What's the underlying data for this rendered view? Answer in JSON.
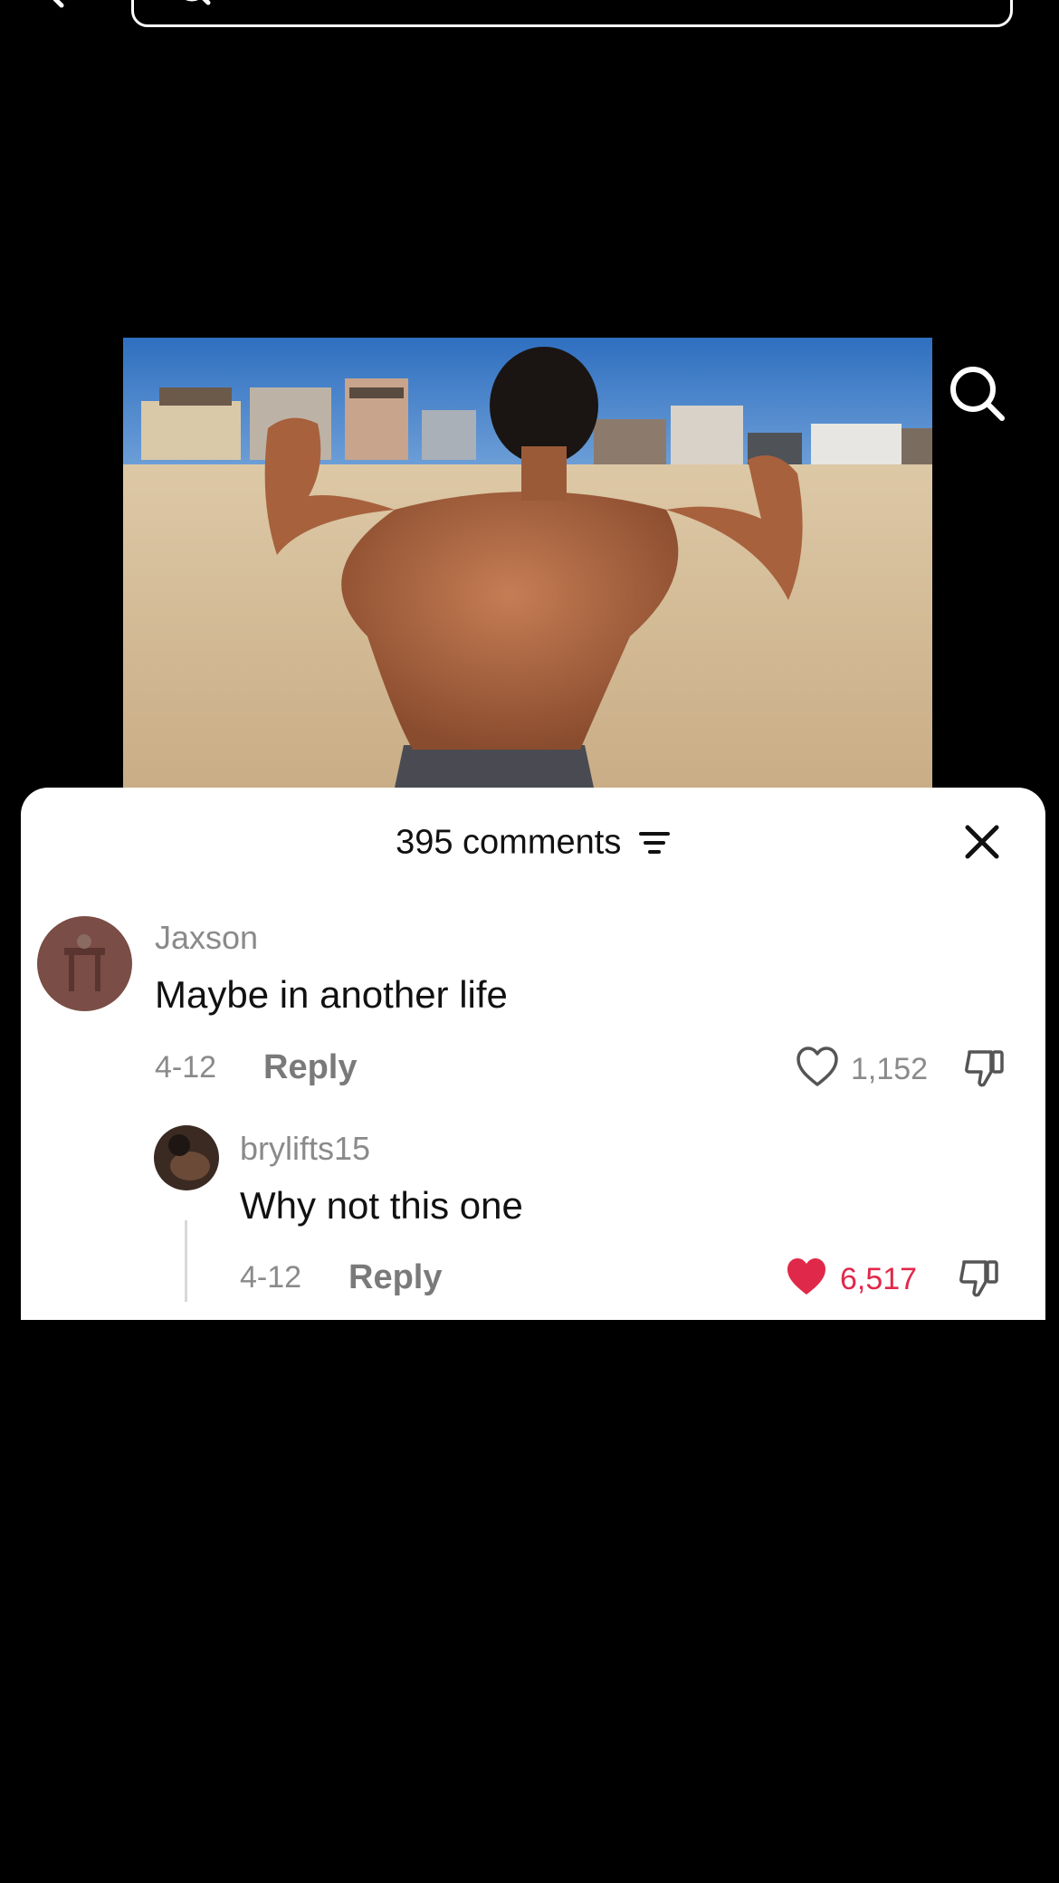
{
  "search_bar": {
    "placeholder": ""
  },
  "comments_panel": {
    "count_label": "395 comments",
    "comments": [
      {
        "username": "Jaxson",
        "text": "Maybe in another life",
        "date": "4-12",
        "reply_label": "Reply",
        "likes": "1,152",
        "liked": false
      },
      {
        "username": "brylifts15",
        "text": "Why not this one",
        "date": "4-12",
        "reply_label": "Reply",
        "likes": "6,517",
        "liked": true
      }
    ]
  },
  "colors": {
    "background": "#000000",
    "sheet": "#ffffff",
    "like_active": "#e0294a",
    "muted_text": "#8a8a8a"
  },
  "icons": [
    "back-icon",
    "search-icon",
    "filter-icon",
    "close-icon",
    "heart-icon",
    "dislike-icon"
  ]
}
